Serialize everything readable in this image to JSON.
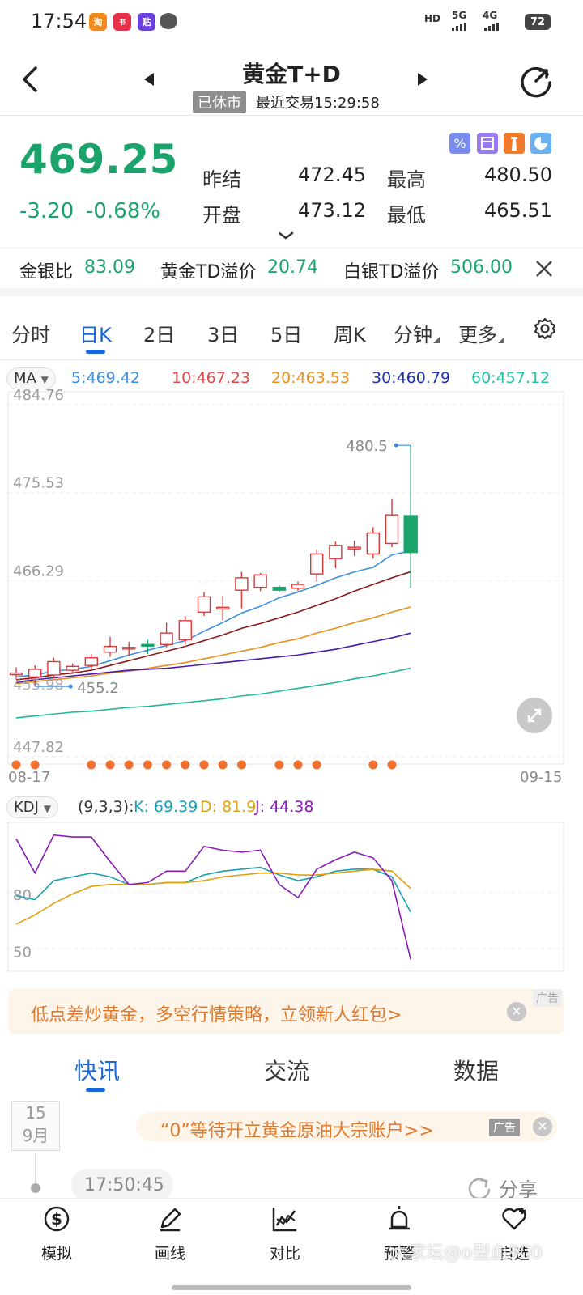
{
  "status": {
    "time": "17:54",
    "network1": "HD",
    "network2": "5G",
    "network3": "4G",
    "battery": "72"
  },
  "header": {
    "title": "黄金T+D",
    "status_badge": "已休市",
    "last_trade": "最近交易15:29:58"
  },
  "quote": {
    "price": "469.25",
    "change": "-3.20",
    "change_pct": "-0.68%",
    "prev_settle_label": "昨结",
    "prev_settle": "472.45",
    "open_label": "开盘",
    "open": "473.12",
    "high_label": "最高",
    "high": "480.50",
    "low_label": "最低",
    "low": "465.51"
  },
  "ratios": {
    "gold_silver_label": "金银比",
    "gold_silver": "83.09",
    "gold_premium_label": "黄金TD溢价",
    "gold_premium": "20.74",
    "silver_premium_label": "白银TD溢价",
    "silver_premium": "506.00"
  },
  "period_tabs": [
    "分时",
    "日K",
    "2日",
    "3日",
    "5日",
    "周K",
    "分钟",
    "更多"
  ],
  "ma": {
    "selector": "MA",
    "items": [
      {
        "label": "5:469.42",
        "color": "#3b8ee0"
      },
      {
        "label": "10:467.23",
        "color": "#e04a4a"
      },
      {
        "label": "20:463.53",
        "color": "#e8901c"
      },
      {
        "label": "30:460.79",
        "color": "#1b2fb0"
      },
      {
        "label": "60:457.12",
        "color": "#1fc4a4"
      }
    ]
  },
  "chart_data": [
    {
      "type": "candlestick",
      "ylim": [
        447.82,
        484.76
      ],
      "y_ticks": [
        "484.76",
        "475.53",
        "466.29",
        "447.82"
      ],
      "x_start": "08-17",
      "x_end": "09-15",
      "max_label": "480.5",
      "min_label": "455.2",
      "min_partial_label": "455.98",
      "candles": [
        {
          "o": 456.6,
          "c": 456.6,
          "h": 457.2,
          "l": 456.0
        },
        {
          "o": 456.2,
          "c": 457.0,
          "h": 457.4,
          "l": 455.2
        },
        {
          "o": 456.4,
          "c": 457.8,
          "h": 458.2,
          "l": 456.0
        },
        {
          "o": 456.9,
          "c": 457.3,
          "h": 457.6,
          "l": 456.5
        },
        {
          "o": 457.4,
          "c": 458.2,
          "h": 458.6,
          "l": 456.9
        },
        {
          "o": 458.8,
          "c": 459.4,
          "h": 460.4,
          "l": 458.3
        },
        {
          "o": 459.2,
          "c": 459.3,
          "h": 459.9,
          "l": 458.4
        },
        {
          "o": 459.6,
          "c": 459.5,
          "h": 460.1,
          "l": 458.6
        },
        {
          "o": 459.6,
          "c": 460.8,
          "h": 461.9,
          "l": 459.3
        },
        {
          "o": 460.1,
          "c": 462.1,
          "h": 462.6,
          "l": 459.6
        },
        {
          "o": 463.0,
          "c": 464.6,
          "h": 465.1,
          "l": 462.6
        },
        {
          "o": 463.5,
          "c": 463.5,
          "h": 464.7,
          "l": 462.1
        },
        {
          "o": 465.3,
          "c": 466.6,
          "h": 467.2,
          "l": 463.4
        },
        {
          "o": 465.6,
          "c": 466.9,
          "h": 467.1,
          "l": 465.2
        },
        {
          "o": 465.6,
          "c": 465.3,
          "h": 465.8,
          "l": 465.1
        },
        {
          "o": 465.5,
          "c": 465.9,
          "h": 466.2,
          "l": 465.2
        },
        {
          "o": 467.0,
          "c": 469.1,
          "h": 469.6,
          "l": 466.2
        },
        {
          "o": 468.6,
          "c": 470.0,
          "h": 470.4,
          "l": 467.6
        },
        {
          "o": 469.7,
          "c": 469.8,
          "h": 470.5,
          "l": 468.9
        },
        {
          "o": 469.1,
          "c": 471.3,
          "h": 471.9,
          "l": 468.6
        },
        {
          "o": 470.2,
          "c": 473.2,
          "h": 474.9,
          "l": 469.8
        },
        {
          "o": 473.12,
          "c": 469.25,
          "h": 480.5,
          "l": 465.51
        }
      ],
      "series": [
        {
          "name": "MA5",
          "color": "#3b8ee0",
          "values": [
            456.2,
            456.4,
            456.8,
            457.0,
            457.3,
            457.9,
            458.5,
            459.0,
            459.5,
            460.0,
            461.0,
            461.9,
            462.9,
            463.6,
            464.5,
            465.1,
            465.8,
            466.6,
            467.2,
            467.7,
            469.0,
            469.42
          ]
        },
        {
          "name": "MA10",
          "color": "#8b1a1a",
          "values": [
            455.9,
            456.1,
            456.4,
            456.6,
            456.9,
            457.4,
            457.9,
            458.4,
            458.9,
            459.4,
            460.0,
            460.6,
            461.3,
            461.8,
            462.4,
            463.0,
            463.7,
            464.4,
            465.2,
            465.9,
            466.6,
            467.23
          ]
        },
        {
          "name": "MA20",
          "color": "#e8901c",
          "values": [
            455.5,
            455.7,
            455.9,
            456.1,
            456.3,
            456.6,
            456.8,
            457.1,
            457.4,
            457.7,
            458.1,
            458.5,
            458.9,
            459.3,
            459.8,
            460.2,
            460.8,
            461.3,
            461.9,
            462.4,
            463.0,
            463.53
          ]
        },
        {
          "name": "MA30",
          "color": "#4a1aa8",
          "values": [
            455.6,
            455.9,
            456.1,
            456.3,
            456.5,
            456.7,
            456.9,
            457.0,
            457.1,
            457.3,
            457.5,
            457.7,
            457.9,
            458.1,
            458.3,
            458.5,
            458.8,
            459.1,
            459.5,
            459.9,
            460.3,
            460.79
          ]
        },
        {
          "name": "MA60",
          "color": "#1fb89a",
          "values": [
            451.9,
            452.1,
            452.3,
            452.5,
            452.6,
            452.8,
            453.0,
            453.1,
            453.3,
            453.5,
            453.7,
            453.9,
            454.2,
            454.4,
            454.7,
            455.0,
            455.3,
            455.6,
            456.0,
            456.3,
            456.7,
            457.12
          ]
        }
      ],
      "signal_dots": [
        0,
        1,
        4,
        5,
        6,
        7,
        8,
        9,
        10,
        11,
        12,
        14,
        15,
        16,
        19,
        20
      ]
    },
    {
      "type": "line",
      "indicator": "KDJ",
      "params": "(9,3,3):",
      "k_label": "K: 69.39",
      "d_label": "D: 81.9",
      "j_label": "J: 44.38",
      "ylim": [
        40,
        115
      ],
      "y_ticks": [
        "80",
        "50"
      ],
      "series": [
        {
          "name": "K",
          "color": "#1aa0b0",
          "values": [
            78,
            76,
            86,
            88,
            90,
            88,
            84,
            84,
            85,
            85,
            89,
            91,
            92,
            93,
            89,
            86,
            88,
            91,
            92,
            92,
            88,
            69.39
          ]
        },
        {
          "name": "D",
          "color": "#e0a010",
          "values": [
            63,
            68,
            74,
            79,
            83,
            84,
            84,
            84,
            85,
            85,
            86,
            88,
            89,
            90,
            90,
            89,
            89,
            90,
            91,
            92,
            91,
            81.9
          ]
        },
        {
          "name": "J",
          "color": "#8a1ab8",
          "values": [
            108,
            90,
            110,
            109,
            109,
            96,
            84,
            85,
            91,
            91,
            104,
            102,
            101,
            102,
            84,
            77,
            92,
            97,
            101,
            98,
            86,
            44.38
          ]
        }
      ]
    }
  ],
  "ad_banner": {
    "text": "低点差炒黄金，多空行情策略，立领新人红包>",
    "tag": "广告"
  },
  "news_tabs": [
    "快讯",
    "交流",
    "数据"
  ],
  "feed": {
    "date_day": "15",
    "date_month": "9月",
    "ad_text": "“0”等待开立黄金原油大宗账户>>",
    "ad_tag": "广告",
    "time": "17:50:45",
    "share": "分享"
  },
  "bottom_nav": [
    "模拟",
    "画线",
    "对比",
    "预警",
    "自选"
  ],
  "watermark": "大家坛@o型血900"
}
